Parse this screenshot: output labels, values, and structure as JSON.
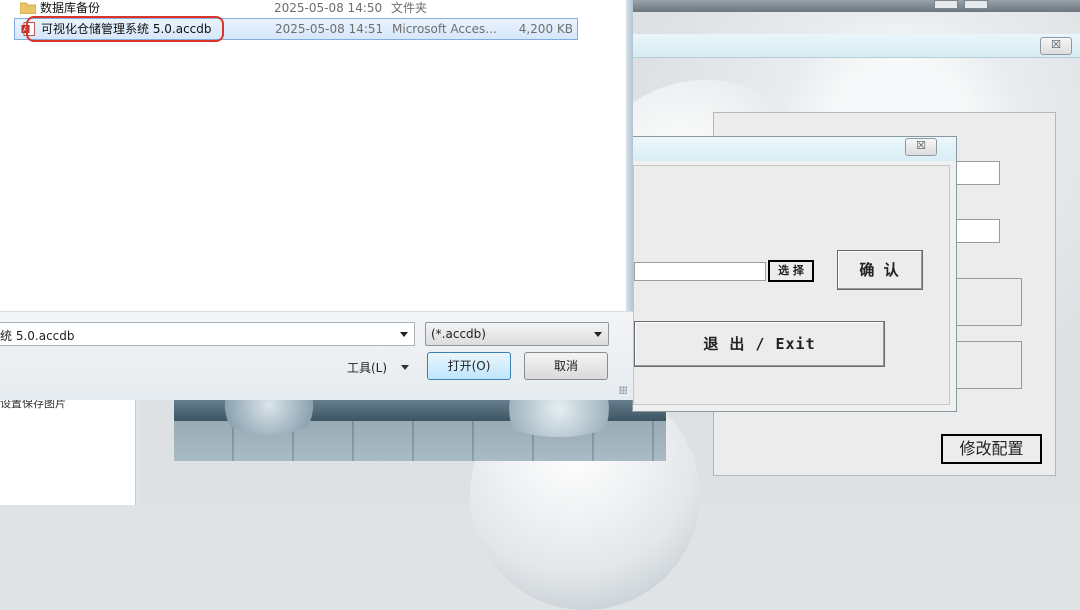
{
  "background_app": {
    "left_strip_text": "设置保存图片",
    "modify_button_label": "修改配置",
    "close_symbol": "☒"
  },
  "mid_dialog": {
    "close_symbol": "☒",
    "select_button_label": "选 择",
    "confirm_button_label": "确 认",
    "exit_button_label": "退 出 / Exit"
  },
  "file_dialog": {
    "files": [
      {
        "name": "数据库备份",
        "date": "2025-05-08 14:50",
        "type": "文件夹",
        "size": "",
        "icon": "folder-icon"
      },
      {
        "name": "可视化仓储管理系统 5.0.accdb",
        "date": "2025-05-08 14:51",
        "type": "Microsoft Acces...",
        "size": "4,200 KB",
        "icon": "access-file-icon"
      }
    ],
    "filename_value": "统 5.0.accdb",
    "filter_value": "(*.accdb)",
    "tools_label": "工具(L)",
    "open_button_label": "打开(O)",
    "cancel_button_label": "取消"
  },
  "colors": {
    "selection": "#d5e7fa",
    "highlight_ring": "#d9352a",
    "open_button": "#bee6fd"
  }
}
